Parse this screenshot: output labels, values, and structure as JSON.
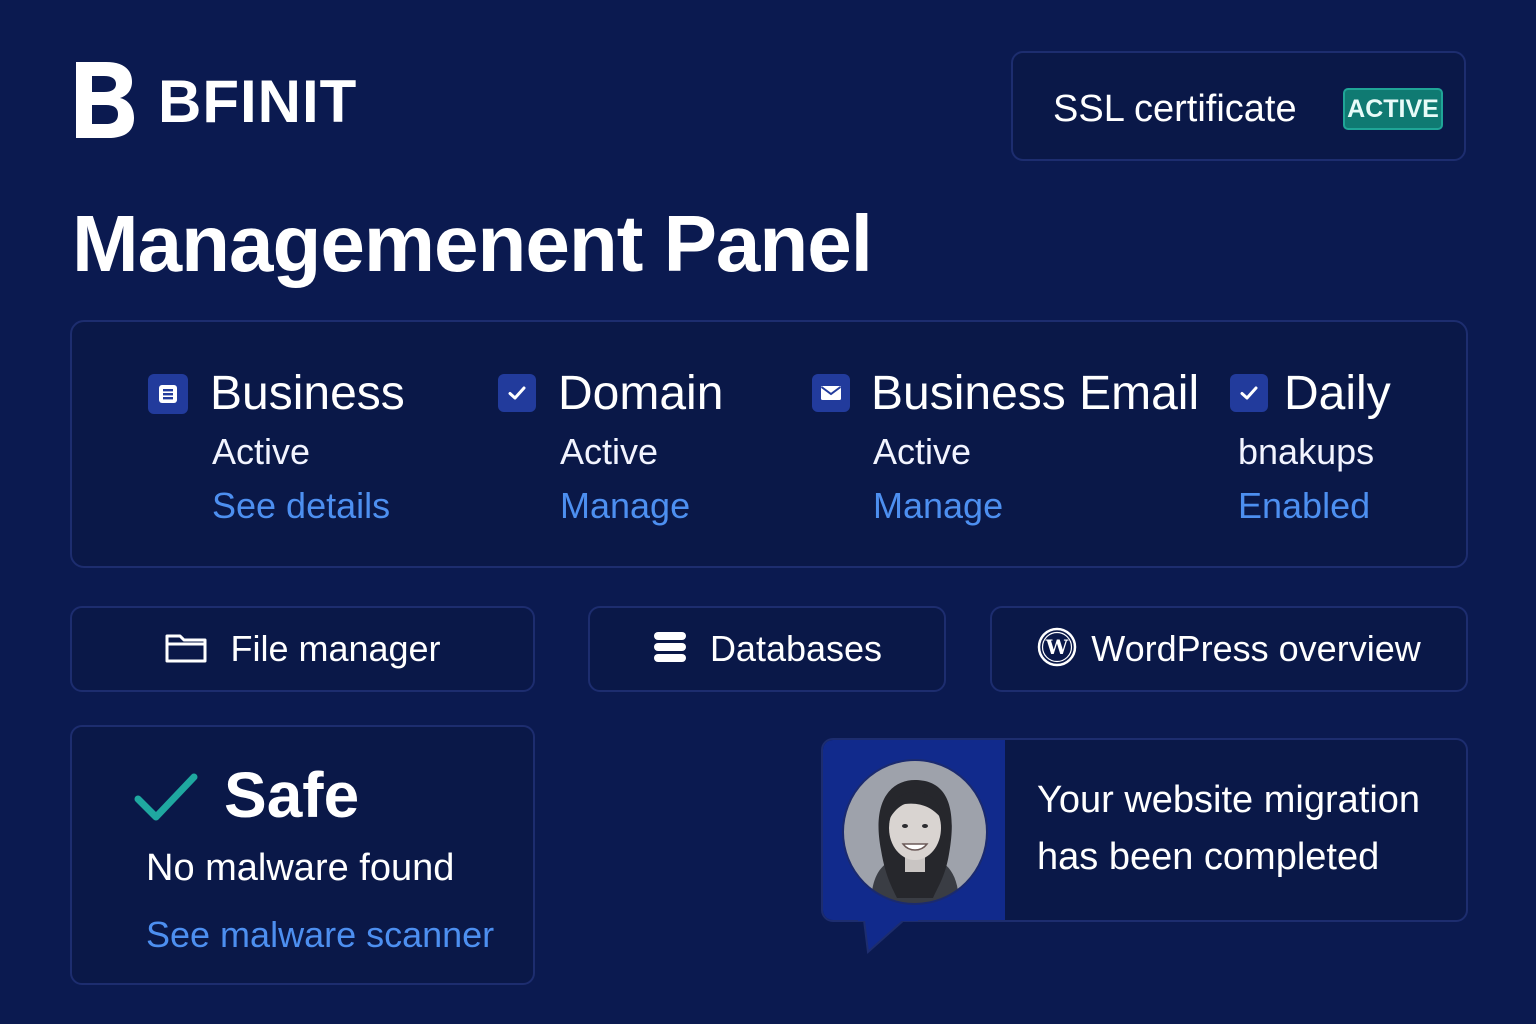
{
  "brand": {
    "name": "BFINIT"
  },
  "ssl": {
    "label": "SSL certificate",
    "badge": "ACTIVE"
  },
  "page_title": "Managemenent Panel",
  "services": [
    {
      "icon": "business-plan-icon",
      "title": "Business",
      "status": "Active",
      "link": "See details"
    },
    {
      "icon": "check-icon",
      "title": "Domain",
      "status": "Active",
      "link": "Manage"
    },
    {
      "icon": "envelope-icon",
      "title": "Business Email",
      "status": "Active",
      "link": "Manage"
    },
    {
      "icon": "check-icon",
      "title": "Daily",
      "status": "bnakups",
      "link": "Enabled"
    }
  ],
  "quick_actions": [
    {
      "icon": "folder-icon",
      "label": "File manager"
    },
    {
      "icon": "database-icon",
      "label": "Databases"
    },
    {
      "icon": "wordpress-icon",
      "label": "WordPress overview"
    }
  ],
  "malware": {
    "title": "Safe",
    "status": "No malware found",
    "link": "See malware scanner"
  },
  "notification": {
    "message": "Your website migration has been completed"
  },
  "colors": {
    "background": "#0b1a50",
    "link": "#4d8ff0",
    "badge": "#0f7a72",
    "check": "#1fa8a0"
  }
}
